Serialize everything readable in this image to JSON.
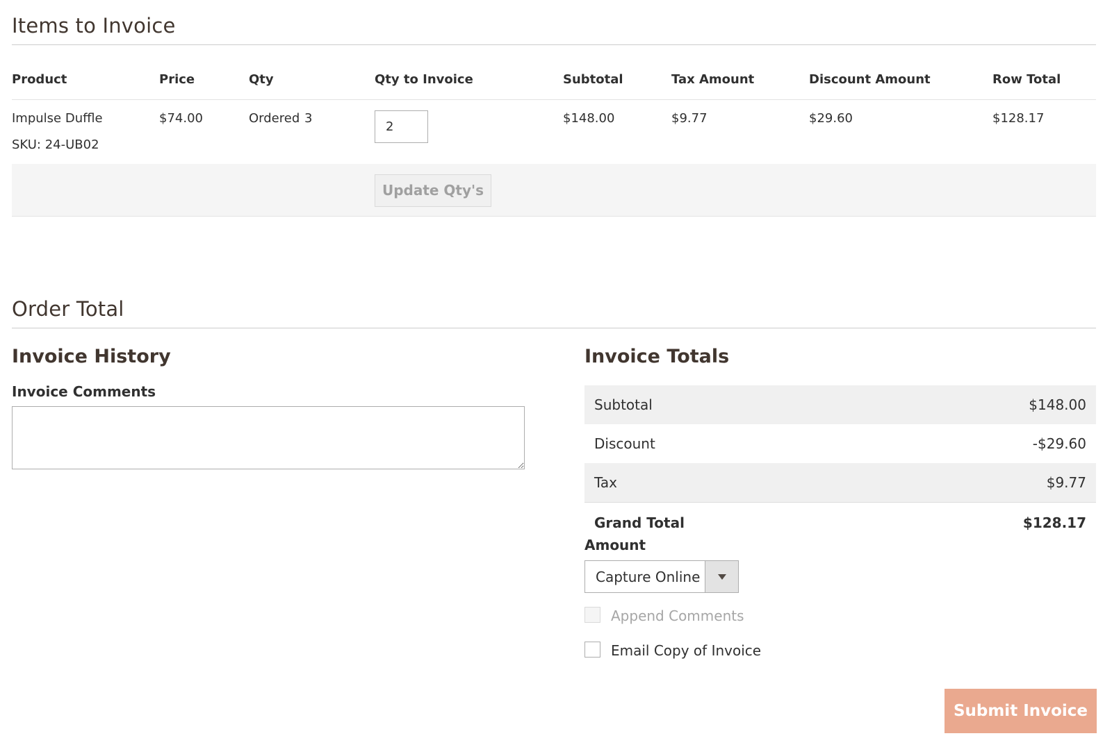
{
  "items_section": {
    "title": "Items to Invoice",
    "columns": [
      "Product",
      "Price",
      "Qty",
      "Qty to Invoice",
      "Subtotal",
      "Tax Amount",
      "Discount Amount",
      "Row Total"
    ],
    "rows": [
      {
        "product": "Impulse Duffle",
        "sku": "SKU: 24-UB02",
        "price": "$74.00",
        "qty_label": "Ordered",
        "qty_value": "3",
        "qty_to_invoice": "2",
        "subtotal": "$148.00",
        "tax": "$9.77",
        "discount": "$29.60",
        "row_total": "$128.17"
      }
    ],
    "update_button": "Update Qty's"
  },
  "order_total": {
    "title": "Order Total",
    "history": {
      "title": "Invoice History",
      "comments_label": "Invoice Comments",
      "comments_value": ""
    },
    "totals": {
      "title": "Invoice Totals",
      "rows": [
        {
          "label": "Subtotal",
          "value": "$148.00"
        },
        {
          "label": "Discount",
          "value": "-$29.60"
        },
        {
          "label": "Tax",
          "value": "$9.77"
        },
        {
          "label": "Grand Total",
          "value": "$128.17"
        }
      ],
      "amount_label": "Amount",
      "amount_selected": "Capture Online",
      "append_comments": {
        "label": "Append Comments",
        "checked": false,
        "disabled": true
      },
      "email_copy": {
        "label": "Email Copy of Invoice",
        "checked": false
      },
      "submit_label": "Submit Invoice"
    }
  },
  "colors": {
    "heading": "#41362f",
    "submit_bg": "#eaa98f",
    "shaded_row": "#f0f0f0"
  }
}
